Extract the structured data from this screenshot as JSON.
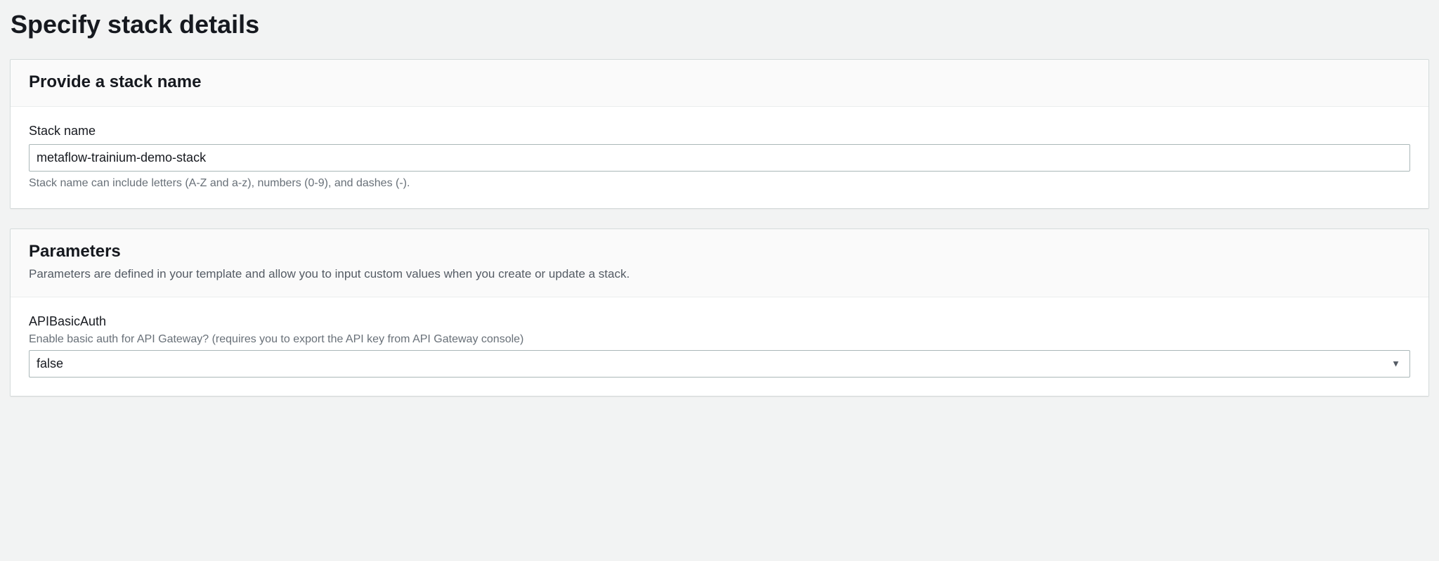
{
  "page": {
    "title": "Specify stack details"
  },
  "stackNameSection": {
    "heading": "Provide a stack name",
    "fieldLabel": "Stack name",
    "value": "metaflow-trainium-demo-stack",
    "hint": "Stack name can include letters (A-Z and a-z), numbers (0-9), and dashes (-)."
  },
  "parametersSection": {
    "heading": "Parameters",
    "subtitle": "Parameters are defined in your template and allow you to input custom values when you create or update a stack.",
    "params": {
      "apiBasicAuth": {
        "label": "APIBasicAuth",
        "description": "Enable basic auth for API Gateway? (requires you to export the API key from API Gateway console)",
        "value": "false"
      }
    }
  }
}
